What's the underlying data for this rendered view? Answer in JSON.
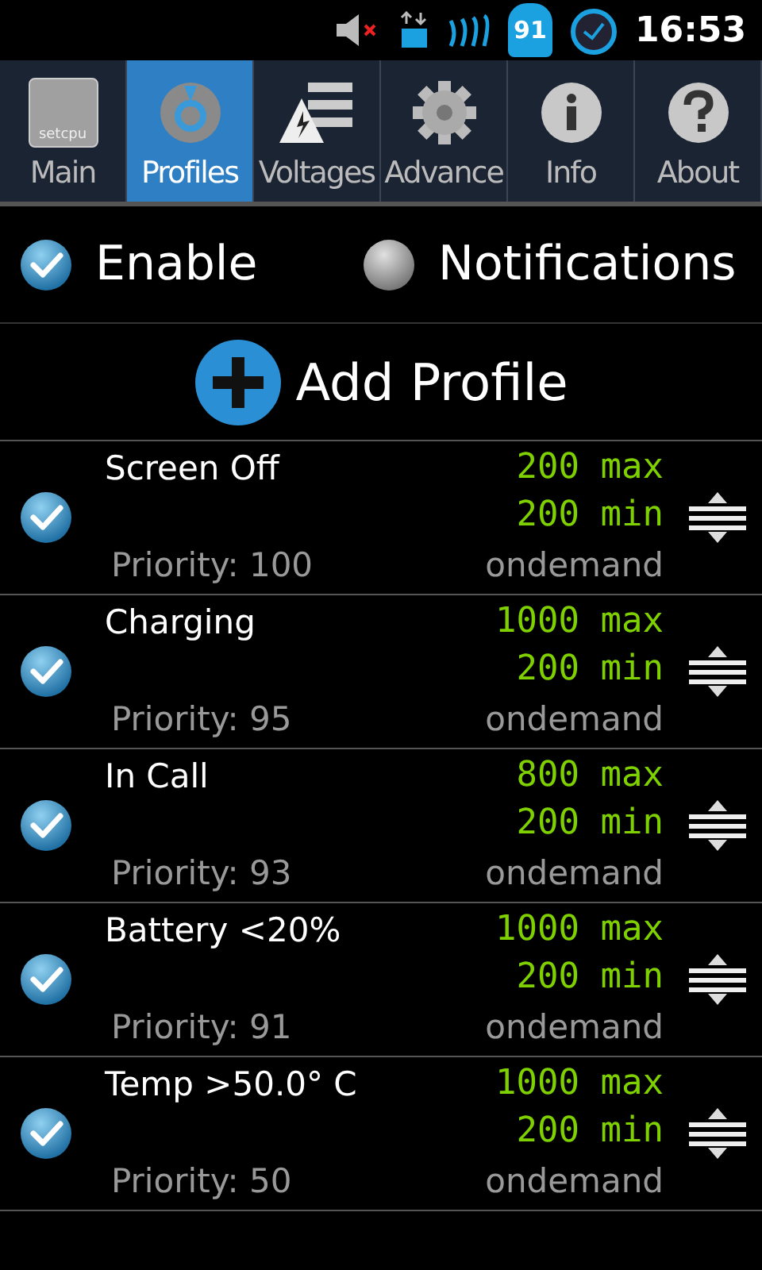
{
  "status_bar": {
    "battery": "91",
    "time": "16:53"
  },
  "tabs": [
    {
      "label": "Main",
      "kind": "main",
      "selected": false
    },
    {
      "label": "Profiles",
      "kind": "profiles",
      "selected": true
    },
    {
      "label": "Voltages",
      "kind": "voltages",
      "selected": false
    },
    {
      "label": "Advance",
      "kind": "advanced",
      "selected": false
    },
    {
      "label": "Info",
      "kind": "info",
      "selected": false
    },
    {
      "label": "About",
      "kind": "about",
      "selected": false
    }
  ],
  "main_tab_logo": "setcpu",
  "options": [
    {
      "label": "Enable",
      "checked": true
    },
    {
      "label": "Notifications",
      "checked": false
    }
  ],
  "add_button": "Add Profile",
  "profiles": [
    {
      "name": "Screen Off",
      "checked": true,
      "max": "200 max",
      "min": "200 min",
      "priority": "Priority: 100",
      "governor": "ondemand"
    },
    {
      "name": "Charging",
      "checked": true,
      "max": "1000 max",
      "min": "200 min",
      "priority": "Priority: 95",
      "governor": "ondemand"
    },
    {
      "name": "In Call",
      "checked": true,
      "max": "800 max",
      "min": "200 min",
      "priority": "Priority: 93",
      "governor": "ondemand"
    },
    {
      "name": "Battery <20%",
      "checked": true,
      "max": "1000 max",
      "min": "200 min",
      "priority": "Priority: 91",
      "governor": "ondemand"
    },
    {
      "name": "Temp >50.0° C",
      "checked": true,
      "max": "1000 max",
      "min": "200 min",
      "priority": "Priority: 50",
      "governor": "ondemand"
    }
  ]
}
